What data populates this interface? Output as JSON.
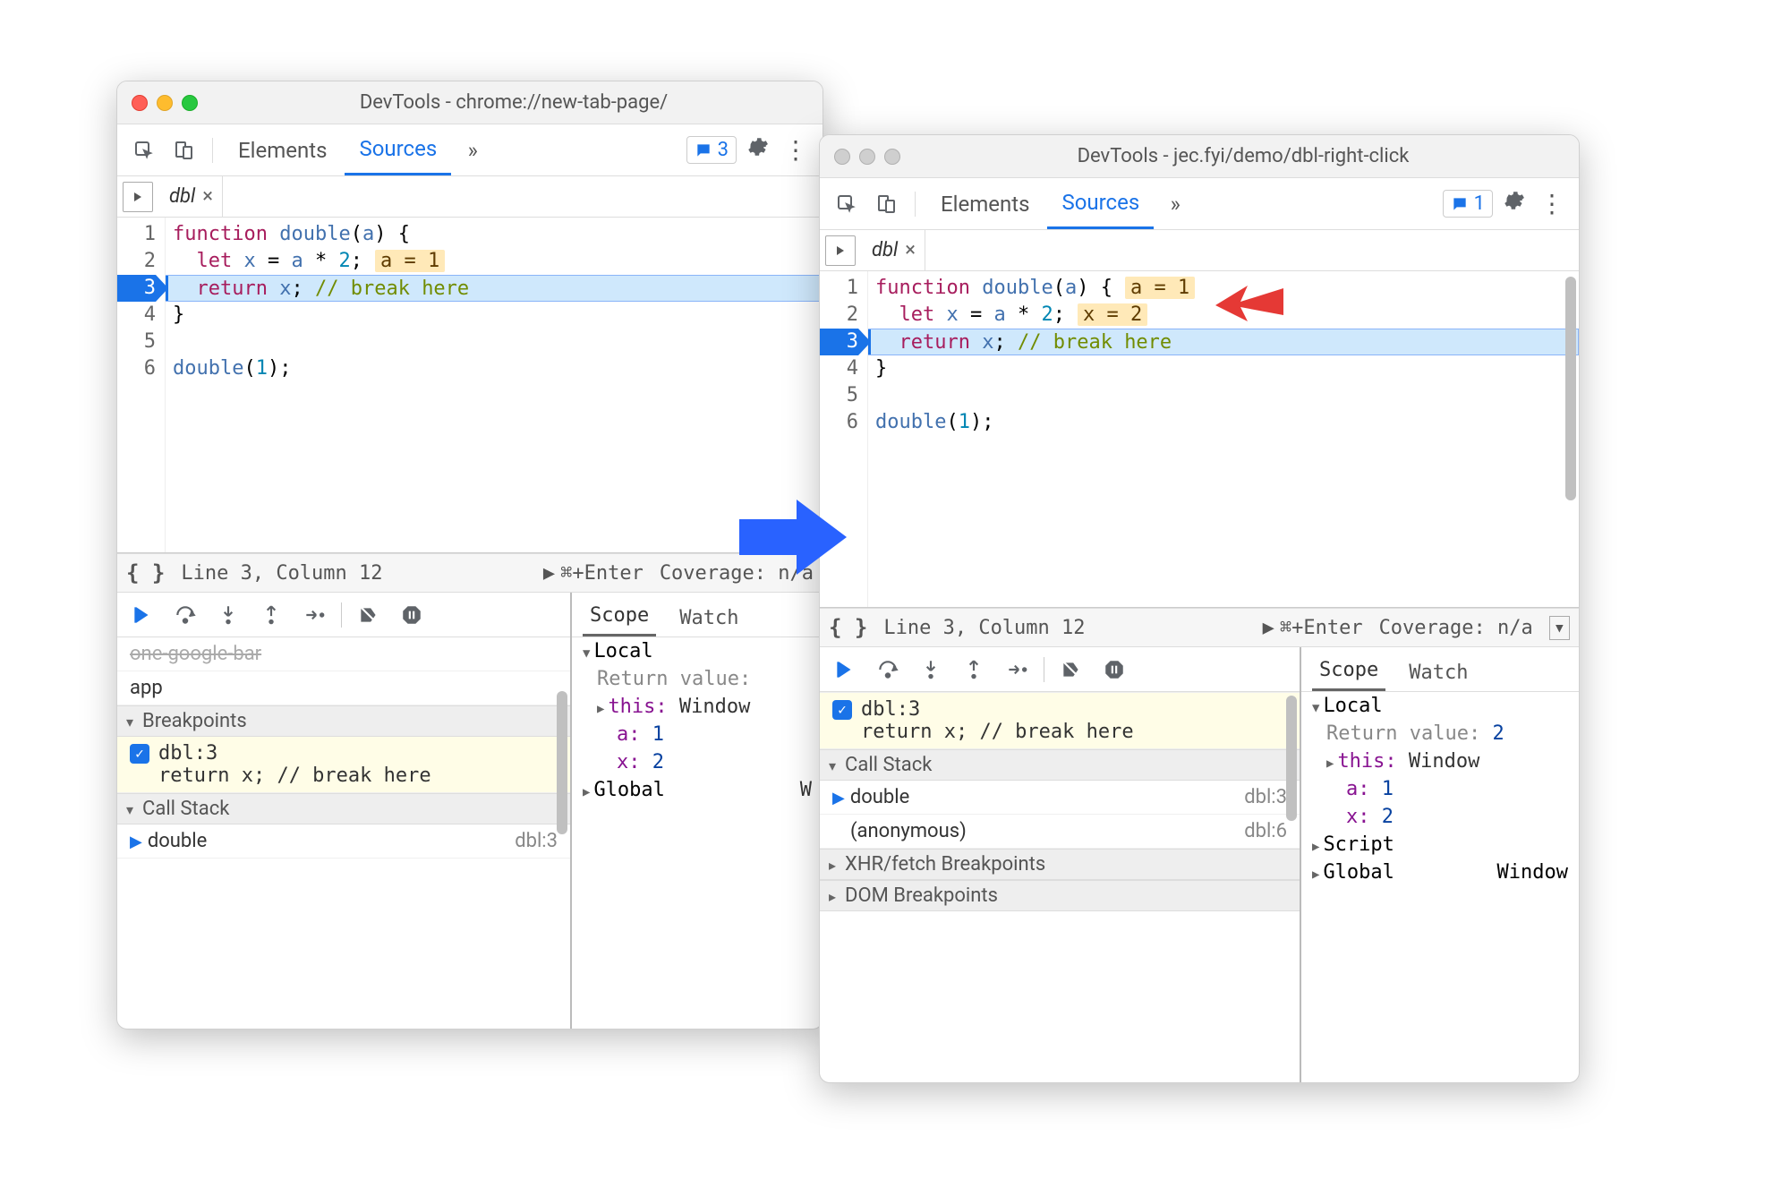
{
  "left": {
    "title": "DevTools - chrome://new-tab-page/",
    "tabs": {
      "elements": "Elements",
      "sources": "Sources"
    },
    "issues_count": "3",
    "file_tab": "dbl",
    "code": {
      "lines": [
        "1",
        "2",
        "3",
        "4",
        "5",
        "6"
      ],
      "l1_kw": "function",
      "l1_fn": "double",
      "l1_arg": "a",
      "l2_kw": "let",
      "l2_x": "x",
      "l2_a": "a",
      "l2_num": "2",
      "l2_inline": "a = 1",
      "l3_kw": "return",
      "l3_var": "x",
      "l3_comment": "// break here",
      "l4": "}",
      "l6_call": "double",
      "l6_arg": "1"
    },
    "status": {
      "curly": "{ }",
      "pos": "Line 3, Column 12",
      "run": "⌘+Enter",
      "coverage": "Coverage: n/a"
    },
    "sections": {
      "breakpoints_hdr": "Breakpoints",
      "callstack_hdr": "Call Stack",
      "bp_label": "dbl:3",
      "bp_code": "return x; // break here",
      "row_app": "app",
      "stack_fn": "double",
      "stack_loc": "dbl:3"
    },
    "scope": {
      "tab_scope": "Scope",
      "tab_watch": "Watch",
      "local": "Local",
      "retval_label": "Return value:",
      "this_label": "this:",
      "this_val": "Window",
      "a_label": "a:",
      "a_val": "1",
      "x_label": "x:",
      "x_val": "2",
      "global": "Global",
      "global_val": "W"
    }
  },
  "right": {
    "title": "DevTools - jec.fyi/demo/dbl-right-click",
    "tabs": {
      "elements": "Elements",
      "sources": "Sources"
    },
    "issues_count": "1",
    "file_tab": "dbl",
    "code": {
      "lines": [
        "1",
        "2",
        "3",
        "4",
        "5",
        "6"
      ],
      "l1_kw": "function",
      "l1_fn": "double",
      "l1_arg": "a",
      "l1_inline": "a = 1",
      "l2_kw": "let",
      "l2_x": "x",
      "l2_a": "a",
      "l2_num": "2",
      "l2_inline": "x = 2",
      "l3_kw": "return",
      "l3_var": "x",
      "l3_comment": "// break here",
      "l4": "}",
      "l6_call": "double",
      "l6_arg": "1"
    },
    "status": {
      "curly": "{ }",
      "pos": "Line 3, Column 12",
      "run": "⌘+Enter",
      "coverage": "Coverage: n/a"
    },
    "sections": {
      "callstack_hdr": "Call Stack",
      "xhr_hdr": "XHR/fetch Breakpoints",
      "dom_hdr": "DOM Breakpoints",
      "bp_label": "dbl:3",
      "bp_code": "return x; // break here",
      "stack_fn": "double",
      "stack_loc": "dbl:3",
      "stack_anon": "(anonymous)",
      "stack_anon_loc": "dbl:6"
    },
    "scope": {
      "tab_scope": "Scope",
      "tab_watch": "Watch",
      "local": "Local",
      "retval_label": "Return value:",
      "retval_val": "2",
      "this_label": "this:",
      "this_val": "Window",
      "a_label": "a:",
      "a_val": "1",
      "x_label": "x:",
      "x_val": "2",
      "script": "Script",
      "global": "Global",
      "global_val": "Window"
    }
  }
}
